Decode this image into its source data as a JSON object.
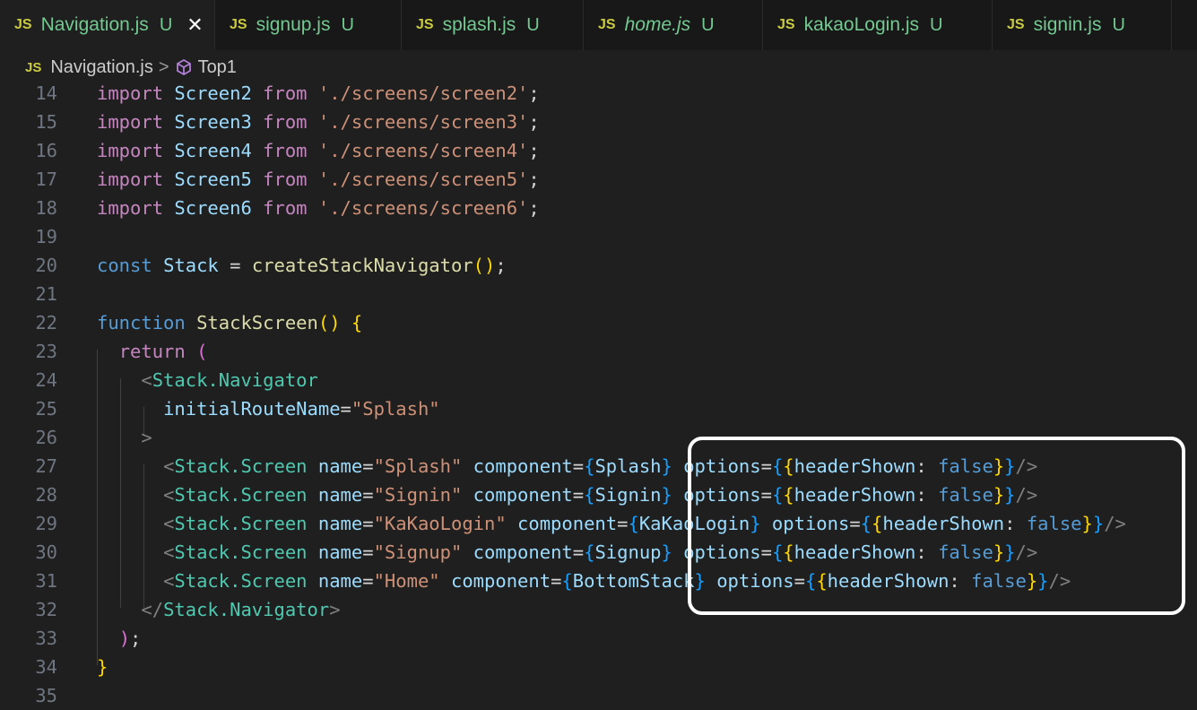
{
  "tabs": [
    {
      "label": "Navigation.js",
      "status": "U",
      "active": true,
      "italic": false,
      "closable": true
    },
    {
      "label": "signup.js",
      "status": "U",
      "active": false,
      "italic": false
    },
    {
      "label": "splash.js",
      "status": "U",
      "active": false,
      "italic": false
    },
    {
      "label": "home.js",
      "status": "U",
      "active": false,
      "italic": true
    },
    {
      "label": "kakaoLogin.js",
      "status": "U",
      "active": false,
      "italic": false
    },
    {
      "label": "signin.js",
      "status": "U",
      "active": false,
      "italic": false
    }
  ],
  "file_badge": "JS",
  "close_glyph": "✕",
  "breadcrumb": {
    "file": "Navigation.js",
    "symbol": "Top1",
    "separator": ">"
  },
  "colors": {
    "keyword_import": "#c586c0",
    "keyword_storage": "#569cd6",
    "variable": "#9cdcfe",
    "function": "#dcdcaa",
    "string": "#ce9178",
    "jsx_tag": "#4ec9b0",
    "modified": "#73c991",
    "highlight_box": "#ffffff"
  },
  "icons": {
    "file": "js-file-icon",
    "symbol": "cube-icon",
    "close": "close-icon"
  },
  "lines": [
    {
      "n": "14",
      "tokens": [
        [
          "import",
          "kw-i"
        ],
        [
          " ",
          "plain"
        ],
        [
          "Screen2",
          "var"
        ],
        [
          " ",
          "plain"
        ],
        [
          "from",
          "kw-i"
        ],
        [
          " ",
          "plain"
        ],
        [
          "'./screens/screen2'",
          "str"
        ],
        [
          ";",
          "plain"
        ]
      ]
    },
    {
      "n": "15",
      "tokens": [
        [
          "import",
          "kw-i"
        ],
        [
          " ",
          "plain"
        ],
        [
          "Screen3",
          "var"
        ],
        [
          " ",
          "plain"
        ],
        [
          "from",
          "kw-i"
        ],
        [
          " ",
          "plain"
        ],
        [
          "'./screens/screen3'",
          "str"
        ],
        [
          ";",
          "plain"
        ]
      ]
    },
    {
      "n": "16",
      "tokens": [
        [
          "import",
          "kw-i"
        ],
        [
          " ",
          "plain"
        ],
        [
          "Screen4",
          "var"
        ],
        [
          " ",
          "plain"
        ],
        [
          "from",
          "kw-i"
        ],
        [
          " ",
          "plain"
        ],
        [
          "'./screens/screen4'",
          "str"
        ],
        [
          ";",
          "plain"
        ]
      ]
    },
    {
      "n": "17",
      "tokens": [
        [
          "import",
          "kw-i"
        ],
        [
          " ",
          "plain"
        ],
        [
          "Screen5",
          "var"
        ],
        [
          " ",
          "plain"
        ],
        [
          "from",
          "kw-i"
        ],
        [
          " ",
          "plain"
        ],
        [
          "'./screens/screen5'",
          "str"
        ],
        [
          ";",
          "plain"
        ]
      ]
    },
    {
      "n": "18",
      "tokens": [
        [
          "import",
          "kw-i"
        ],
        [
          " ",
          "plain"
        ],
        [
          "Screen6",
          "var"
        ],
        [
          " ",
          "plain"
        ],
        [
          "from",
          "kw-i"
        ],
        [
          " ",
          "plain"
        ],
        [
          "'./screens/screen6'",
          "str"
        ],
        [
          ";",
          "plain"
        ]
      ]
    },
    {
      "n": "19",
      "tokens": []
    },
    {
      "n": "20",
      "tokens": [
        [
          "const",
          "kw-s"
        ],
        [
          " ",
          "plain"
        ],
        [
          "Stack",
          "var"
        ],
        [
          " = ",
          "plain"
        ],
        [
          "createStackNavigator",
          "fn"
        ],
        [
          "()",
          "br1"
        ],
        [
          ";",
          "plain"
        ]
      ]
    },
    {
      "n": "21",
      "tokens": []
    },
    {
      "n": "22",
      "tokens": [
        [
          "function",
          "kw-s"
        ],
        [
          " ",
          "plain"
        ],
        [
          "StackScreen",
          "fn"
        ],
        [
          "()",
          "br1"
        ],
        [
          " ",
          "plain"
        ],
        [
          "{",
          "br1"
        ]
      ]
    },
    {
      "n": "23",
      "tokens": [
        [
          "  ",
          "plain"
        ],
        [
          "return",
          "kw-i"
        ],
        [
          " ",
          "plain"
        ],
        [
          "(",
          "br2"
        ]
      ]
    },
    {
      "n": "24",
      "tokens": [
        [
          "    ",
          "plain"
        ],
        [
          "<",
          "pun"
        ],
        [
          "Stack.Navigator",
          "tag"
        ]
      ]
    },
    {
      "n": "25",
      "tokens": [
        [
          "      ",
          "plain"
        ],
        [
          "initialRouteName",
          "var"
        ],
        [
          "=",
          "plain"
        ],
        [
          "\"Splash\"",
          "str"
        ]
      ]
    },
    {
      "n": "26",
      "tokens": [
        [
          "    ",
          "plain"
        ],
        [
          ">",
          "pun"
        ]
      ]
    },
    {
      "n": "27",
      "tokens": [
        [
          "      ",
          "plain"
        ],
        [
          "<",
          "pun"
        ],
        [
          "Stack.Screen",
          "tag"
        ],
        [
          " ",
          "plain"
        ],
        [
          "name",
          "var"
        ],
        [
          "=",
          "plain"
        ],
        [
          "\"Splash\"",
          "str"
        ],
        [
          " ",
          "plain"
        ],
        [
          "component",
          "var"
        ],
        [
          "=",
          "plain"
        ],
        [
          "{",
          "br3"
        ],
        [
          "Splash",
          "var"
        ],
        [
          "}",
          "br3"
        ],
        [
          " ",
          "plain"
        ],
        [
          "options",
          "var"
        ],
        [
          "=",
          "plain"
        ],
        [
          "{",
          "br3"
        ],
        [
          "{",
          "br1"
        ],
        [
          "headerShown",
          "var"
        ],
        [
          ": ",
          "plain"
        ],
        [
          "false",
          "kw-s"
        ],
        [
          "}",
          "br1"
        ],
        [
          "}",
          "br3"
        ],
        [
          "/>",
          "pun"
        ]
      ]
    },
    {
      "n": "28",
      "tokens": [
        [
          "      ",
          "plain"
        ],
        [
          "<",
          "pun"
        ],
        [
          "Stack.Screen",
          "tag"
        ],
        [
          " ",
          "plain"
        ],
        [
          "name",
          "var"
        ],
        [
          "=",
          "plain"
        ],
        [
          "\"Signin\"",
          "str"
        ],
        [
          " ",
          "plain"
        ],
        [
          "component",
          "var"
        ],
        [
          "=",
          "plain"
        ],
        [
          "{",
          "br3"
        ],
        [
          "Signin",
          "var"
        ],
        [
          "}",
          "br3"
        ],
        [
          " ",
          "plain"
        ],
        [
          "options",
          "var"
        ],
        [
          "=",
          "plain"
        ],
        [
          "{",
          "br3"
        ],
        [
          "{",
          "br1"
        ],
        [
          "headerShown",
          "var"
        ],
        [
          ": ",
          "plain"
        ],
        [
          "false",
          "kw-s"
        ],
        [
          "}",
          "br1"
        ],
        [
          "}",
          "br3"
        ],
        [
          "/>",
          "pun"
        ]
      ]
    },
    {
      "n": "29",
      "tokens": [
        [
          "      ",
          "plain"
        ],
        [
          "<",
          "pun"
        ],
        [
          "Stack.Screen",
          "tag"
        ],
        [
          " ",
          "plain"
        ],
        [
          "name",
          "var"
        ],
        [
          "=",
          "plain"
        ],
        [
          "\"KaKaoLogin\"",
          "str"
        ],
        [
          " ",
          "plain"
        ],
        [
          "component",
          "var"
        ],
        [
          "=",
          "plain"
        ],
        [
          "{",
          "br3"
        ],
        [
          "KaKaoLogin",
          "var"
        ],
        [
          "}",
          "br3"
        ],
        [
          " ",
          "plain"
        ],
        [
          "options",
          "var"
        ],
        [
          "=",
          "plain"
        ],
        [
          "{",
          "br3"
        ],
        [
          "{",
          "br1"
        ],
        [
          "headerShown",
          "var"
        ],
        [
          ": ",
          "plain"
        ],
        [
          "false",
          "kw-s"
        ],
        [
          "}",
          "br1"
        ],
        [
          "}",
          "br3"
        ],
        [
          "/>",
          "pun"
        ]
      ]
    },
    {
      "n": "30",
      "tokens": [
        [
          "      ",
          "plain"
        ],
        [
          "<",
          "pun"
        ],
        [
          "Stack.Screen",
          "tag"
        ],
        [
          " ",
          "plain"
        ],
        [
          "name",
          "var"
        ],
        [
          "=",
          "plain"
        ],
        [
          "\"Signup\"",
          "str"
        ],
        [
          " ",
          "plain"
        ],
        [
          "component",
          "var"
        ],
        [
          "=",
          "plain"
        ],
        [
          "{",
          "br3"
        ],
        [
          "Signup",
          "var"
        ],
        [
          "}",
          "br3"
        ],
        [
          " ",
          "plain"
        ],
        [
          "options",
          "var"
        ],
        [
          "=",
          "plain"
        ],
        [
          "{",
          "br3"
        ],
        [
          "{",
          "br1"
        ],
        [
          "headerShown",
          "var"
        ],
        [
          ": ",
          "plain"
        ],
        [
          "false",
          "kw-s"
        ],
        [
          "}",
          "br1"
        ],
        [
          "}",
          "br3"
        ],
        [
          "/>",
          "pun"
        ]
      ]
    },
    {
      "n": "31",
      "tokens": [
        [
          "      ",
          "plain"
        ],
        [
          "<",
          "pun"
        ],
        [
          "Stack.Screen",
          "tag"
        ],
        [
          " ",
          "plain"
        ],
        [
          "name",
          "var"
        ],
        [
          "=",
          "plain"
        ],
        [
          "\"Home\"",
          "str"
        ],
        [
          " ",
          "plain"
        ],
        [
          "component",
          "var"
        ],
        [
          "=",
          "plain"
        ],
        [
          "{",
          "br3"
        ],
        [
          "BottomStack",
          "var"
        ],
        [
          "}",
          "br3"
        ],
        [
          " ",
          "plain"
        ],
        [
          "options",
          "var"
        ],
        [
          "=",
          "plain"
        ],
        [
          "{",
          "br3"
        ],
        [
          "{",
          "br1"
        ],
        [
          "headerShown",
          "var"
        ],
        [
          ": ",
          "plain"
        ],
        [
          "false",
          "kw-s"
        ],
        [
          "}",
          "br1"
        ],
        [
          "}",
          "br3"
        ],
        [
          "/>",
          "pun"
        ]
      ]
    },
    {
      "n": "32",
      "tokens": [
        [
          "    ",
          "plain"
        ],
        [
          "</",
          "pun"
        ],
        [
          "Stack.Navigator",
          "tag"
        ],
        [
          ">",
          "pun"
        ]
      ]
    },
    {
      "n": "33",
      "tokens": [
        [
          "  ",
          "plain"
        ],
        [
          ")",
          "br2"
        ],
        [
          ";",
          "plain"
        ]
      ]
    },
    {
      "n": "34",
      "tokens": [
        [
          "}",
          "br1"
        ]
      ]
    },
    {
      "n": "35",
      "tokens": []
    }
  ]
}
